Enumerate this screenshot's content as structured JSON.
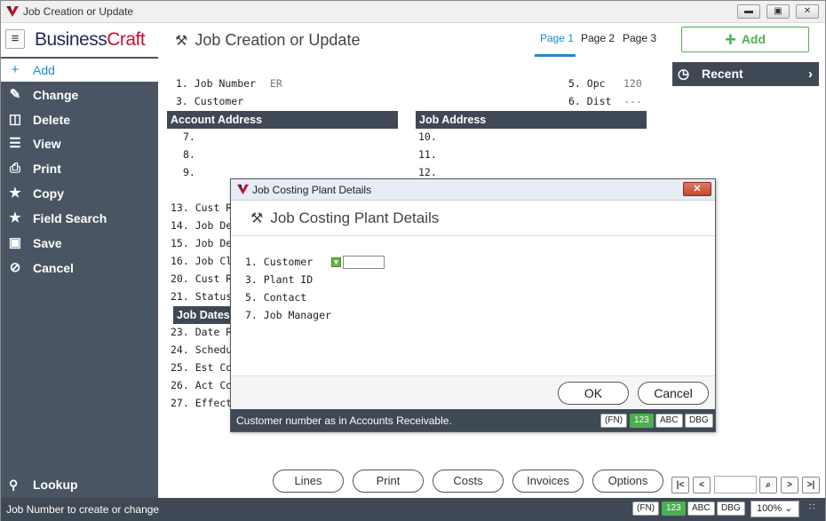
{
  "window": {
    "title": "Job Creation or Update"
  },
  "header": {
    "brand_main": "Business",
    "brand_accent": "Craft",
    "page_title": "Job Creation or Update",
    "tabs": [
      {
        "label": "Page 1",
        "active": true
      },
      {
        "label": "Page 2"
      },
      {
        "label": "Page 3"
      }
    ],
    "add_label": "Add"
  },
  "sidebar": {
    "items": [
      {
        "label": "Add",
        "icon": "plus-icon"
      },
      {
        "label": "Change",
        "icon": "pencil-icon"
      },
      {
        "label": "Delete",
        "icon": "trash-icon"
      },
      {
        "label": "View",
        "icon": "list-icon"
      },
      {
        "label": "Print",
        "icon": "printer-icon"
      },
      {
        "label": "Copy",
        "icon": "star-icon"
      },
      {
        "label": "Field Search",
        "icon": "star-icon"
      },
      {
        "label": "Save",
        "icon": "save-icon"
      },
      {
        "label": "Cancel",
        "icon": "cancel-icon"
      }
    ],
    "lookup_label": "Lookup"
  },
  "form": {
    "f1_label": "1. Job Number",
    "f1_value": "ER",
    "f3_label": "3. Customer",
    "f5_label": "5. Opc",
    "f5_value": "120",
    "f6_label": "6. Dist",
    "f6_value": "---",
    "account_address": "Account Address",
    "job_address": "Job Address",
    "f7": "7.",
    "f8": "8.",
    "f9": "9.",
    "f10": "10.",
    "f11": "11.",
    "f12": "12.",
    "f13": "13. Cust R",
    "f14": "14. Job De",
    "f15": "15. Job De",
    "f16": "16. Job Cl",
    "f20": "20. Cust R",
    "f21": "21. Status",
    "job_dates": "Job Dates",
    "f23": "23. Date R",
    "f24": "24. Schedu",
    "f25": "25. Est Co",
    "f26": "26. Act Co",
    "f27": "27. Effect"
  },
  "recent": {
    "label": "Recent"
  },
  "bottom_buttons": [
    "Lines",
    "Print",
    "Costs",
    "Invoices",
    "Options"
  ],
  "nav": {
    "first": "|<",
    "prev": "<",
    "search": "⌕",
    "next": ">",
    "last": ">|"
  },
  "status": {
    "message": "Job Number to create or change",
    "fn": "(FN)",
    "num": "123",
    "abc": "ABC",
    "dbg": "DBG",
    "zoom": "100%"
  },
  "dialog": {
    "title": "Job Costing Plant Details",
    "heading": "Job Costing Plant Details",
    "fields": [
      "1. Customer",
      "3. Plant ID",
      "5. Contact",
      "7. Job Manager"
    ],
    "ok": "OK",
    "cancel": "Cancel",
    "status_message": "Customer number as in Accounts Receivable.",
    "fn": "(FN)",
    "num": "123",
    "abc": "ABC",
    "dbg": "DBG"
  },
  "colors": {
    "accent": "#1a8ad4",
    "green": "#4caf50",
    "dark": "#3f4855",
    "sidebar": "#4a5564"
  }
}
